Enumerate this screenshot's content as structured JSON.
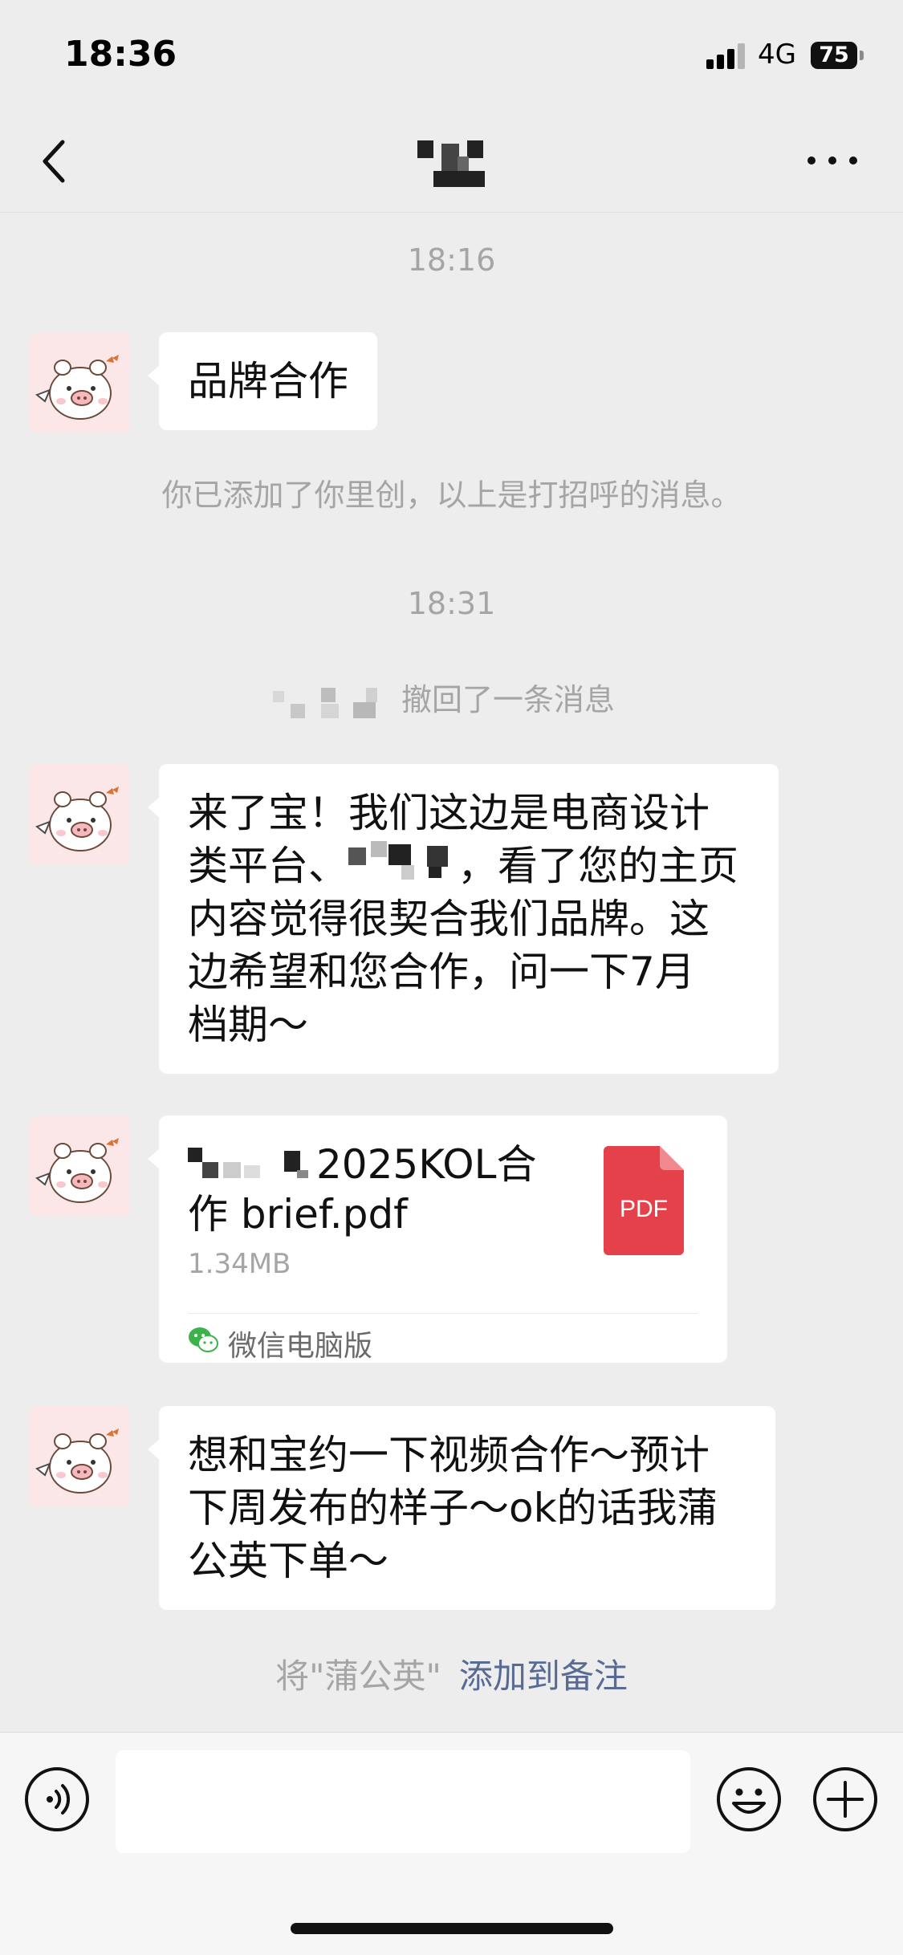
{
  "status_bar": {
    "time": "18:36",
    "network": "4G",
    "battery": "75"
  },
  "nav": {
    "back_icon": "chevron-left-icon",
    "more_icon": "more-dots-icon"
  },
  "chat": {
    "timestamps": [
      "18:16",
      "18:31"
    ],
    "messages": [
      {
        "text": "品牌合作"
      },
      {
        "text_before": "来了宝！我们这边是电商设计\n类平台、",
        "text_after": "，看了您的主页\n内容觉得很契合我们品牌。这\n边希望和您合作，问一下7月\n档期～"
      },
      {
        "text": "想和宝约一下视频合作～预计\n下周发布的样子～ok的话我蒲\n公英下单～"
      }
    ],
    "system_note": "你已添加了你里创，以上是打招呼的消息。",
    "recall_note": "撤回了一条消息",
    "file": {
      "name": "2025KOL合\n作 brief.pdf",
      "size": "1.34MB",
      "type_label": "PDF",
      "source": "微信电脑版",
      "pdf_color": "#e5414a"
    },
    "remark": {
      "prefix": "将\"蒲公英\"",
      "link": "添加到备注",
      "link_color": "#576b95"
    }
  },
  "input_bar": {
    "voice_icon": "voice-icon",
    "emoji_icon": "emoji-icon",
    "plus_icon": "plus-icon"
  }
}
